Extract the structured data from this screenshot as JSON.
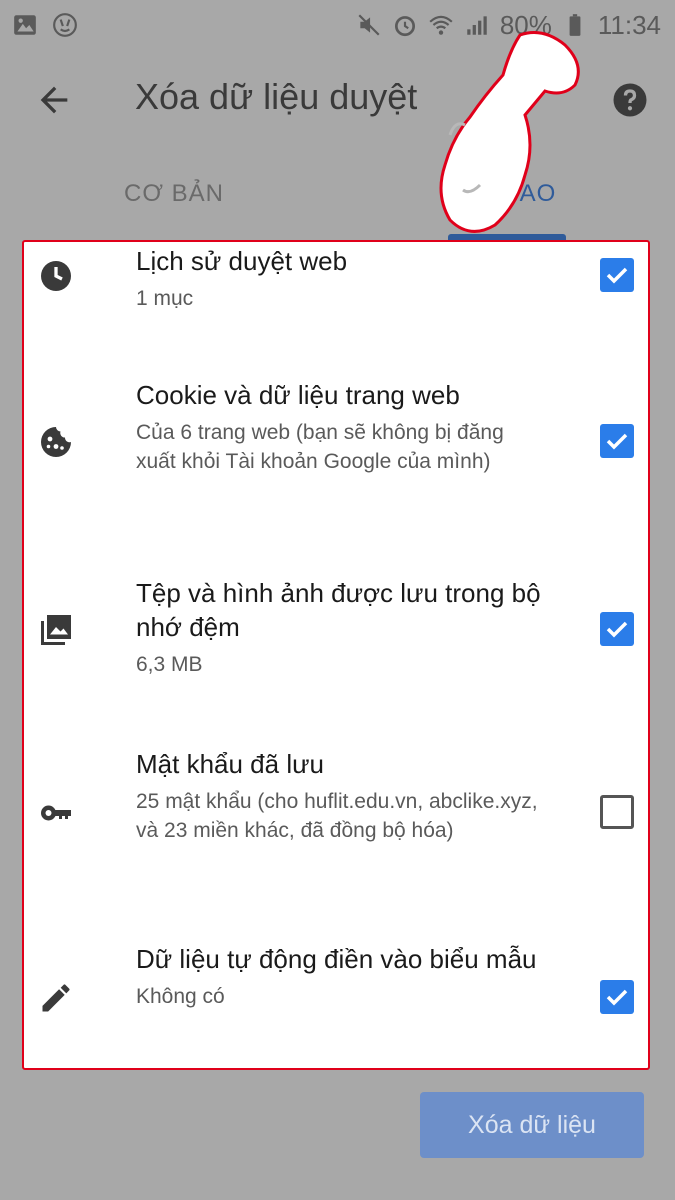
{
  "status_bar": {
    "battery": "80%",
    "time": "11:34"
  },
  "toolbar": {
    "title": "Xóa dữ liệu duyệt"
  },
  "tabs": [
    {
      "label": "CƠ BẢN",
      "active": false
    },
    {
      "label": "NG CAO",
      "active": true
    }
  ],
  "items": [
    {
      "icon": "clock-icon",
      "title": "Lịch sử duyệt web",
      "subtitle": "1 mục",
      "checked": true
    },
    {
      "icon": "cookie-icon",
      "title": "Cookie và dữ liệu trang web",
      "subtitle": "Của 6 trang web (bạn sẽ không bị đăng xuất khỏi Tài khoản Google của mình)",
      "checked": true
    },
    {
      "icon": "images-icon",
      "title": "Tệp và hình ảnh được lưu trong bộ nhớ đệm",
      "subtitle": "6,3 MB",
      "checked": true
    },
    {
      "icon": "key-icon",
      "title": "Mật khẩu đã lưu",
      "subtitle": "25 mật khẩu (cho huflit.edu.vn, abclike.xyz, và 23 miền khác, đã đồng bộ hóa)",
      "checked": false
    },
    {
      "icon": "pencil-icon",
      "title": "Dữ liệu tự động điền vào biểu mẫu",
      "subtitle": "Không có",
      "checked": true
    }
  ],
  "clear_button": {
    "label": "Xóa dữ liệu"
  },
  "colors": {
    "accent": "#2b7de9",
    "highlight_border": "#e0001a",
    "overlay": "#a8a8a8"
  }
}
